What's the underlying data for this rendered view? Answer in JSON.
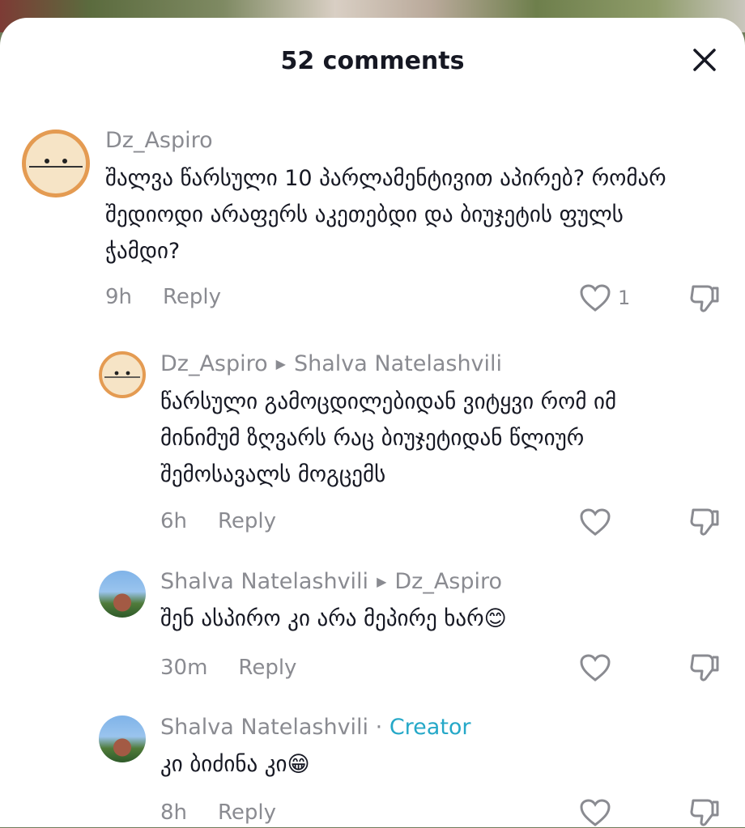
{
  "header": {
    "title": "52 comments"
  },
  "comments": [
    {
      "author": "Dz_Aspiro",
      "text": "შალვა წარსული 10 პარლამენტივით აპირებ? რომარ შედიოდი არაფერს აკეთებდი და ბიუჯეტის ფულს ჭამდი?",
      "time": "9h",
      "reply": "Reply",
      "likes": "1"
    },
    {
      "author": "Dz_Aspiro",
      "reply_to": "Shalva Natelashvili",
      "text": "წარსული გამოცდილებიდან ვიტყვი რომ იმ მინიმუმ ზღვარს რაც ბიუჯეტიდან წლიურ შემოსავალს მოგცემს",
      "time": "6h",
      "reply": "Reply"
    },
    {
      "author": "Shalva Natelashvili",
      "reply_to": "Dz_Aspiro",
      "text": "შენ ასპირო კი არა მეპირე ხარ😊",
      "time": "30m",
      "reply": "Reply"
    },
    {
      "author": "Shalva Natelashvili",
      "badge": "Creator",
      "text": "კი ბიძინა კი😁",
      "time": "8h",
      "reply": "Reply"
    }
  ],
  "icons": {
    "close": "close-icon",
    "like": "heart-icon",
    "dislike": "thumbs-down-icon",
    "reply_arrow": "triangle-right-icon"
  },
  "colors": {
    "creator_badge": "#25a8c8",
    "secondary_text": "#8a8b91",
    "primary_text": "#161823"
  }
}
